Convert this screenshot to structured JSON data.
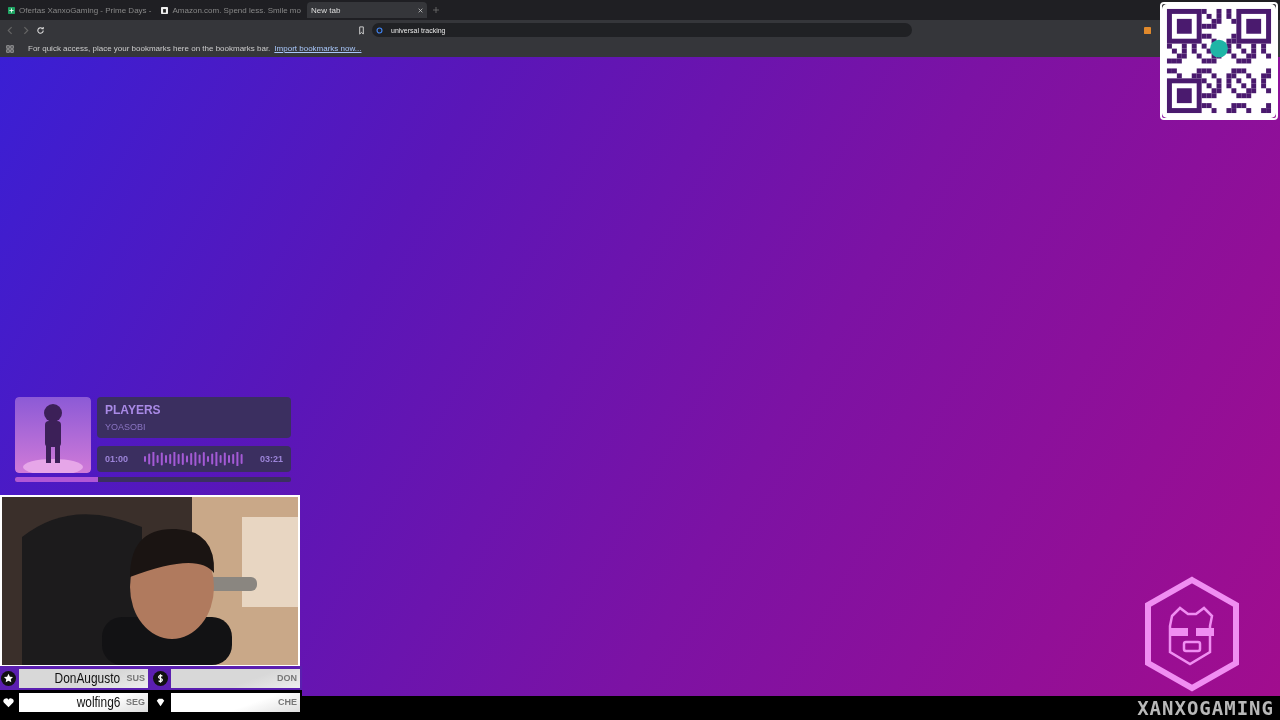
{
  "browser": {
    "tabs": [
      {
        "title": "Ofertas XanxoGaming - Prime Days -",
        "kind": "sheet",
        "selected": false
      },
      {
        "title": "Amazon.com. Spend less. Smile mo",
        "kind": "amazon",
        "selected": false
      },
      {
        "title": "New tab",
        "kind": "blank",
        "selected": true
      }
    ],
    "address": {
      "value": "universal tracking"
    },
    "bookmarks_bar": {
      "message": "For quick access, place your bookmarks here on the bookmarks bar.",
      "link": "Import bookmarks now..."
    }
  },
  "music_player": {
    "title": "PLAYERS",
    "artist": "YOASOBI",
    "elapsed": "01:00",
    "duration": "03:21",
    "level": 0.3
  },
  "stream_labels": [
    [
      {
        "kind": "star",
        "name": "DonAugusto",
        "tag": "SUS"
      },
      {
        "kind": "dollar",
        "tag": "DON"
      }
    ],
    [
      {
        "kind": "heart",
        "name": "wolfing6",
        "tag": "SEG"
      },
      {
        "kind": "diamond",
        "tag": "CHE"
      }
    ]
  ],
  "brand": {
    "name": "XANXOGAMING"
  }
}
